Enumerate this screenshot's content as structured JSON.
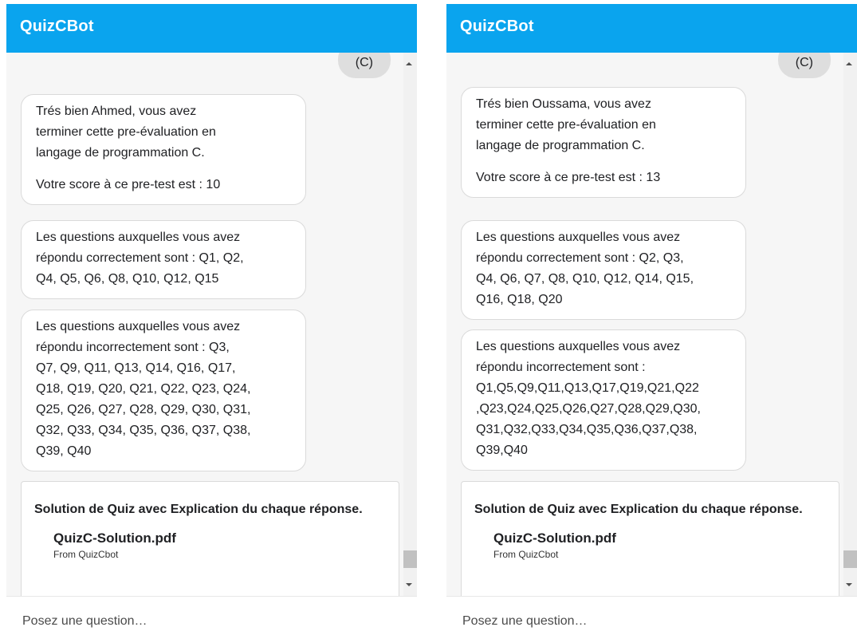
{
  "panels": [
    {
      "header_title": "QuizCBot",
      "user_message": "(C)",
      "messages": [
        {
          "lines": [
            "Trés bien Ahmed, vous avez",
            "terminer cette pre-évaluation en",
            "langage de programmation C."
          ],
          "score": "Votre score à ce pre-test est : 10"
        },
        {
          "lines": [
            "Les questions auxquelles vous avez",
            "répondu correctement sont : Q1, Q2,",
            "Q4, Q5, Q6, Q8, Q10, Q12, Q15"
          ]
        },
        {
          "lines": [
            "Les questions auxquelles vous avez",
            "répondu incorrectement sont : Q3,",
            "Q7, Q9, Q11, Q13, Q14, Q16, Q17,",
            "Q18, Q19, Q20, Q21, Q22, Q23, Q24,",
            "Q25, Q26, Q27, Q28, Q29, Q30, Q31,",
            "Q32, Q33, Q34, Q35, Q36, Q37, Q38,",
            "Q39, Q40"
          ]
        }
      ],
      "card": {
        "title": "Solution de Quiz avec Explication du chaque réponse.",
        "file_name": "QuizC-Solution.pdf",
        "file_from": "From QuizCbot"
      },
      "input_placeholder": "Posez une question…"
    },
    {
      "header_title": "QuizCBot",
      "user_message": "(C)",
      "messages": [
        {
          "lines": [
            "Trés bien Oussama, vous avez",
            "terminer cette pre-évaluation en",
            "langage de programmation C."
          ],
          "score": "Votre score à ce pre-test est : 13"
        },
        {
          "lines": [
            "Les questions auxquelles vous avez",
            "répondu correctement sont : Q2, Q3,",
            "Q4, Q6, Q7, Q8, Q10, Q12, Q14, Q15,",
            "Q16, Q18, Q20"
          ]
        },
        {
          "lines": [
            "Les questions auxquelles vous avez",
            "répondu incorrectement sont :",
            "Q1,Q5,Q9,Q11,Q13,Q17,Q19,Q21,Q22",
            ",Q23,Q24,Q25,Q26,Q27,Q28,Q29,Q30,",
            "Q31,Q32,Q33,Q34,Q35,Q36,Q37,Q38,",
            "Q39,Q40"
          ]
        }
      ],
      "card": {
        "title": "Solution de Quiz avec Explication du chaque réponse.",
        "file_name": "QuizC-Solution.pdf",
        "file_from": "From QuizCbot"
      },
      "input_placeholder": "Posez une question…"
    }
  ],
  "colors": {
    "header": "#0aa4ee",
    "chat_background": "#f6f6f6",
    "user_bubble": "#dedede",
    "bot_bubble": "#ffffff"
  },
  "icons": {
    "scroll_up": "scroll-up-arrow-icon",
    "scroll_down": "scroll-down-arrow-icon"
  }
}
